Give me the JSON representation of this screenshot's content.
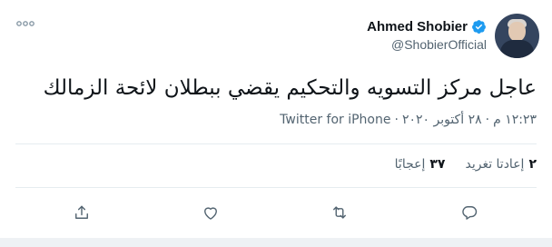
{
  "tweet": {
    "author": {
      "display_name": "Ahmed Shobier",
      "handle": "@ShobierOfficial",
      "verified": true
    },
    "text": "عاجل مركز التسويه والتحكيم يقضي ببطلان لائحة الزمالك",
    "time": "١٢:٢٣ م",
    "date": "٢٨ أكتوبر ٢٠٢٠",
    "separator": "·",
    "source": "Twitter for iPhone",
    "stats": {
      "retweets_count": "٢",
      "retweets_label": "إعادتا تغريد",
      "likes_count": "٣٧",
      "likes_label": "إعجابًا"
    }
  },
  "icons": {
    "more": "more-dots-icon",
    "verified": "verified-badge-icon",
    "reply": "reply-icon",
    "retweet": "retweet-icon",
    "like": "heart-icon",
    "share": "share-icon"
  },
  "colors": {
    "verified_blue": "#1d9bf0",
    "secondary_text": "#536471",
    "primary_text": "#0f1419",
    "divider": "#e6ecf0"
  }
}
